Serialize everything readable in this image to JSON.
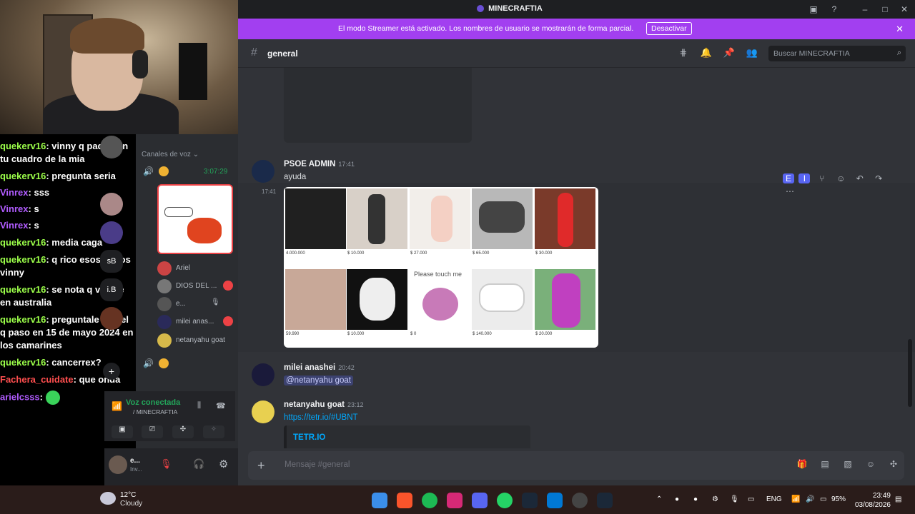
{
  "window": {
    "title": "MINECRAFTIA"
  },
  "banner": {
    "message": "El modo Streamer está activado. Los nombres de usuario se mostrarán de forma parcial.",
    "button": "Desactivar"
  },
  "channel": {
    "name": "general",
    "search_placeholder": "Buscar MINECRAFTIA"
  },
  "messages": [
    {
      "author": "PSOE ADMIN",
      "time": "17:41",
      "text": "ayuda",
      "side_time": "17:41",
      "gallery": [
        {
          "price": "4.000.000"
        },
        {
          "price": "$ 10.000"
        },
        {
          "price": "$ 27.000"
        },
        {
          "price": "$ 65.000"
        },
        {
          "price": "$ 30.000"
        },
        {
          "price": "59.990"
        },
        {
          "price": "$ 10.000"
        },
        {
          "price": "$ 0"
        },
        {
          "price": "$ 140.000"
        },
        {
          "price": "$ 20.000"
        }
      ],
      "gallery_caption": "Please touch me"
    },
    {
      "author": "milei anashei",
      "time": "20:42",
      "mention": "@netanyahu goat"
    },
    {
      "author": "netanyahu goat",
      "time": "23:12",
      "link": "https://tetr.io/#UBNT",
      "embed_title": "TETR.IO"
    }
  ],
  "composer": {
    "placeholder": "Mensaje #general"
  },
  "chat_overlay": [
    {
      "user": "quekerv16",
      "text": "vinny q pado con tu cuadro de la mia",
      "color": "green"
    },
    {
      "user": "quekerv16",
      "text": "pregunta seria",
      "color": "green"
    },
    {
      "user": "Vinrex",
      "text": "sss",
      "color": "purple"
    },
    {
      "user": "Vinrex",
      "text": "s",
      "color": "purple"
    },
    {
      "user": "Vinrex",
      "text": "s",
      "color": "purple"
    },
    {
      "user": "quekerv16",
      "text": "media caga",
      "color": "green"
    },
    {
      "user": "quekerv16",
      "text": "q rico esos dedos vinny",
      "color": "green"
    },
    {
      "user": "quekerv16",
      "text": "se nota q viviste en australia",
      "color": "green"
    },
    {
      "user": "quekerv16",
      "text": "preguntale a ariel q paso en 15 de mayo 2024 en los camarines",
      "color": "green"
    },
    {
      "user": "quekerv16",
      "text": "cancerrex?",
      "color": "green"
    },
    {
      "user": "Fachera_cuidate",
      "text": "que onda",
      "color": "red"
    },
    {
      "user": "arielcsss",
      "text": "",
      "color": "purple"
    }
  ],
  "voice_panel": {
    "header": "Canales de voz",
    "timer": "3:07:29",
    "members": [
      "Ariel",
      "DIOS DEL ...",
      "e...",
      "milei anas...",
      "netanyahu goat"
    ],
    "status": "Voz conectada",
    "server": "/ MINECRAFTIA",
    "user_name": "e...",
    "user_status": "Inv..."
  },
  "taskbar": {
    "temp": "12°C",
    "condition": "Cloudy",
    "lang": "ENG",
    "battery": "95%",
    "time": "23:49",
    "date": "03/08/2026"
  }
}
